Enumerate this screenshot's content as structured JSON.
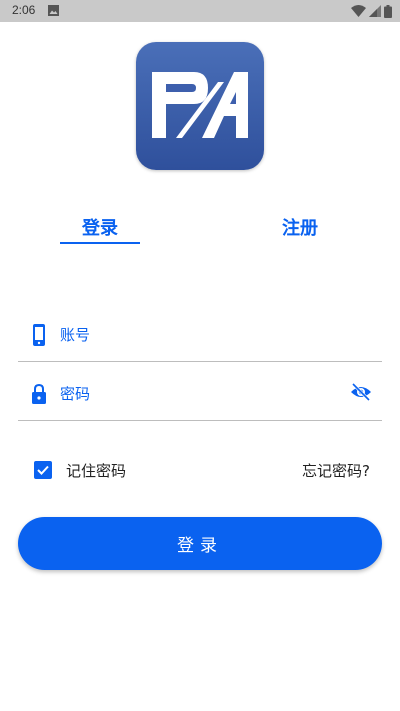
{
  "status_bar": {
    "time": "2:06",
    "icons": [
      "image-icon",
      "wifi-icon",
      "signal-icon",
      "battery-icon"
    ]
  },
  "logo": {
    "text": "PA"
  },
  "tabs": [
    {
      "label": "登录",
      "active": true
    },
    {
      "label": "注册",
      "active": false
    }
  ],
  "form": {
    "account": {
      "placeholder": "账号",
      "value": "",
      "icon": "phone-icon"
    },
    "password": {
      "placeholder": "密码",
      "value": "",
      "icon": "lock-icon",
      "toggle_icon": "eye-off-icon"
    },
    "remember": {
      "label": "记住密码",
      "checked": true
    },
    "forgot_label": "忘记密码?",
    "submit_label": "登录"
  },
  "colors": {
    "accent": "#0a62f0",
    "logo_bg": "#3a5ba8",
    "status_bar": "#c9c9c9",
    "divider": "#bdbdbd"
  }
}
